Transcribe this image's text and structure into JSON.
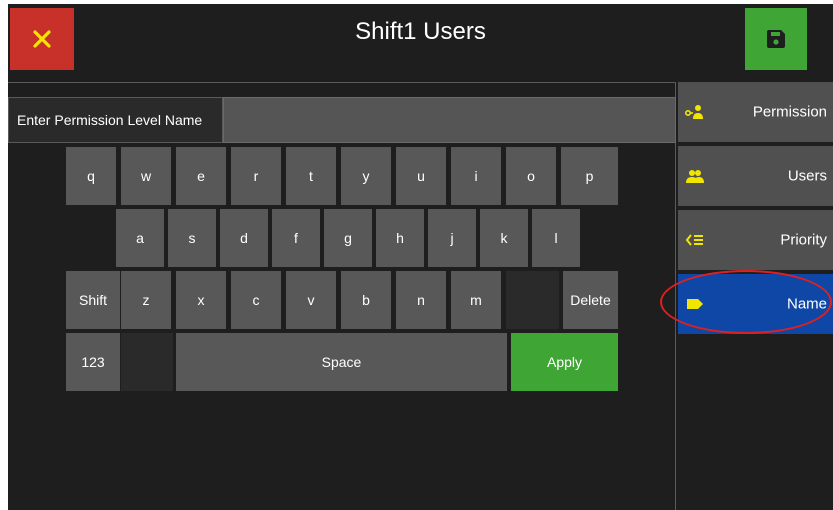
{
  "header": {
    "title": "Shift1 Users"
  },
  "buttons": {
    "close_icon": "close-icon",
    "save_icon": "save-icon"
  },
  "input": {
    "label": "Enter Permission Level Name",
    "value": ""
  },
  "keyboard": {
    "row1": [
      "q",
      "w",
      "e",
      "r",
      "t",
      "y",
      "u",
      "i",
      "o",
      "p"
    ],
    "row2": [
      "a",
      "s",
      "d",
      "f",
      "g",
      "h",
      "j",
      "k",
      "l"
    ],
    "row3": [
      "Shift",
      "z",
      "x",
      "c",
      "v",
      "b",
      "n",
      "m",
      "",
      "Delete"
    ],
    "row4": {
      "numbers": "123",
      "space": "Space",
      "apply": "Apply"
    }
  },
  "sidebar": {
    "items": [
      {
        "label": "Permission",
        "icon": "permission-icon",
        "active": false
      },
      {
        "label": "Users",
        "icon": "users-icon",
        "active": false
      },
      {
        "label": "Priority",
        "icon": "priority-icon",
        "active": false
      },
      {
        "label": "Name",
        "icon": "name-tag-icon",
        "active": true
      }
    ]
  },
  "colors": {
    "background": "#1e1e1e",
    "key": "#585858",
    "close": "#c8302a",
    "save": "#3fa535",
    "apply": "#3fa535",
    "active": "#0f47a6",
    "icon_accent": "#f2e600",
    "annotation": "#e02020"
  }
}
